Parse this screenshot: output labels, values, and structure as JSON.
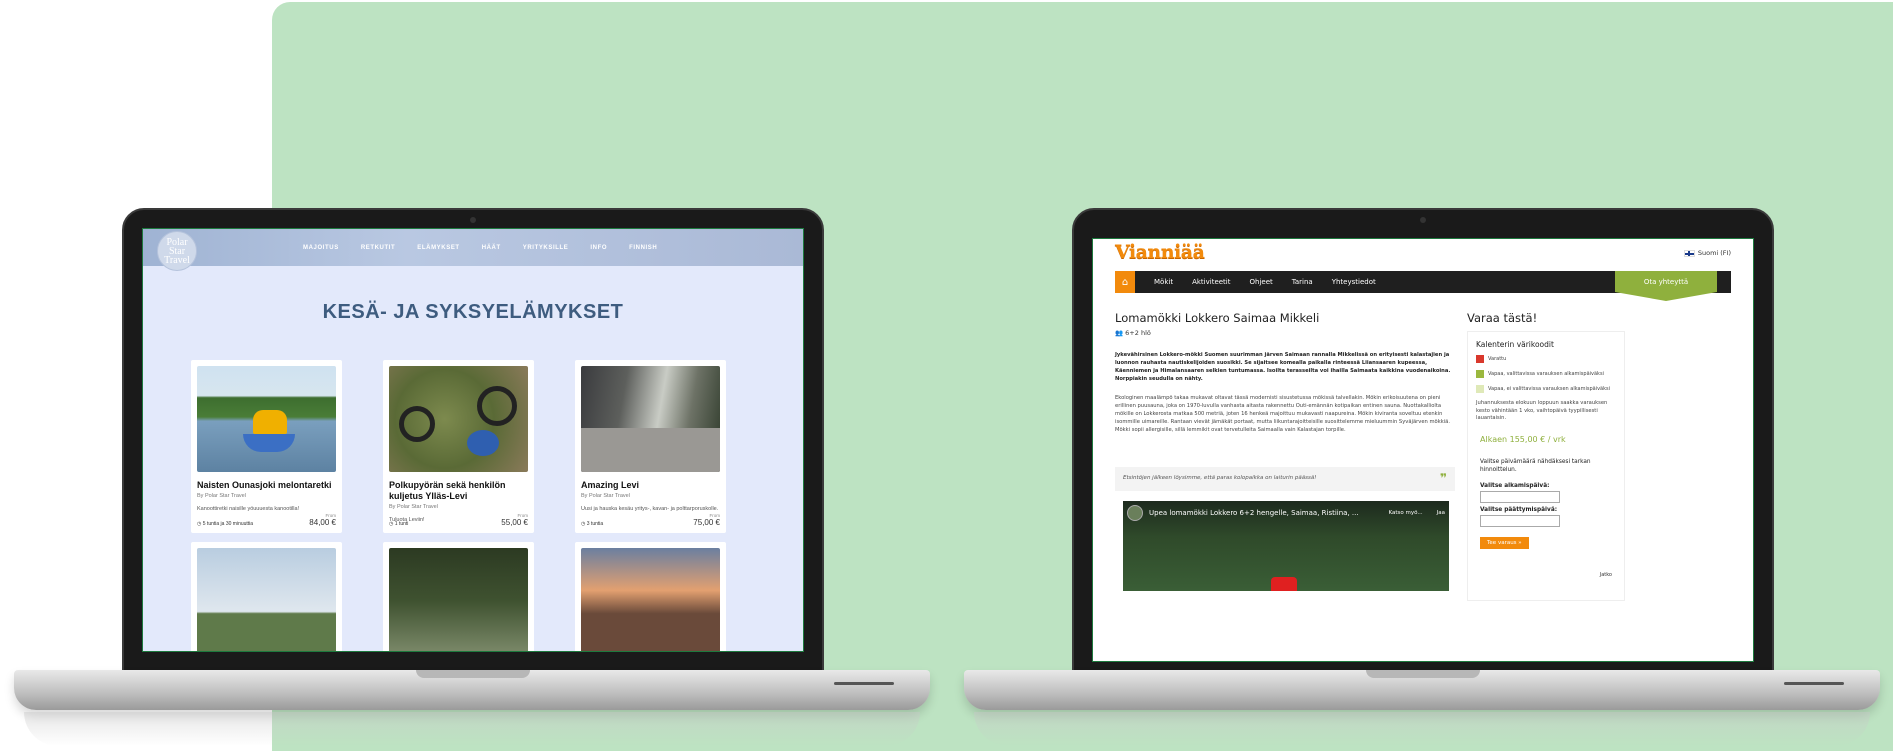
{
  "left_site": {
    "logo": "Polar Star Travel",
    "nav": [
      "MAJOITUS",
      "RETKUTIT",
      "ELÄMYKSET",
      "HÄÄT",
      "YRITYKSILLE",
      "INFO",
      "FINNISH"
    ],
    "title": "KESÄ- JA SYKSYELÄMYKSET",
    "cards": [
      {
        "title": "Naisten Ounasjoki melontaretki",
        "by": "By Polar Star Travel",
        "desc": "Kanoottiretki naisille yöuuuesta kanootilla!",
        "duration": "5 tuntia ja 30 minuuttia",
        "from": "From",
        "price": "84,00 €"
      },
      {
        "title": "Polkupyörän sekä henkilön kuljetus Ylläs-Levi",
        "by": "By Polar Star Travel",
        "desc": "Tuluota Leviin!",
        "duration": "1 tunti",
        "from": "From",
        "price": "55,00 €"
      },
      {
        "title": "Amazing Levi",
        "by": "By Polar Star Travel",
        "desc": "Uusi ja hauska kesäu yritys-, kavan- ja polttarporuskolle.",
        "duration": "3 tuntia",
        "from": "From",
        "price": "75,00 €"
      }
    ]
  },
  "right_site": {
    "logo": "Vianniää",
    "language": "Suomi (FI)",
    "nav": [
      "Mökit",
      "Aktiviteetit",
      "Ohjeet",
      "Tarina",
      "Yhteystiedot"
    ],
    "contact_button": "Ota yhteyttä",
    "title": "Lomamökki Lokkero Saimaa Mikkeli",
    "people": "6+2 hlö",
    "intro": "Jykevähirsinen Lokkero-mökki Suomen suurimman järven Saimaan rannalla Mikkelissä on erityisesti kalastajien ja luonnon rauhasta nautiskelijoiden suosikki. Se sijaitsee komealla paikalla rinteessä Liiansaaren kupeessa, Käenniemen ja Himalansaaren selkien tuntumassa. Isoilta terasseilta voi ihailla Saimaata kaikkina vuodenaikoina. Norppiakin seudulla on nähty.",
    "body": "Ekologinen maalämpö takaa mukavat oltavat tässä modernisti sisustetussa mökissä talvellakin. Mökin erikoisuutena on pieni erillinen puusauna, joka on 1970-luvulla vanhasta aitasta rakennettu Outi-emännän kotipaikan entinen sauna. Nuottakalliolta mökille on Lokkerosta matkaa 500 metriä, joten 16 henkeä majoittuu mukavasti naapureina. Mökin kiviranta soveltuu etenkin isommille uimareille. Rantaan vievät jämäkät portaat, mutta liikuntarajoitteisille suosittelemme mieluummin Syväjärven mökkiä. Mökki sopii allergisille, sillä lemmikit ovat tervetulleita Saimaalla vain Kalastajan torpille.",
    "quote": "Etsintöjen jälkeen löysimme, että paras kolopaikka on laiturin päässä!",
    "video_title": "Upea lomamökki Lokkero 6+2 hengelle, Saimaa, Ristiina, ...",
    "video_watch": "Katso myö...",
    "video_share": "Jaa",
    "side_title": "Varaa tästä!",
    "calendar_title": "Kalenterin värikoodit",
    "legend": [
      {
        "label": "Varattu",
        "color": "#d9382c"
      },
      {
        "label": "Vapaa, valittavissa varauksen alkamispäiväksi",
        "color": "#9bb83e"
      },
      {
        "label": "Vapaa, ei valittavissa varauksen alkamispäiväksi",
        "color": "#dfe9b8"
      }
    ],
    "note": "Juhannuksesta elokuun loppuun saakka varauksen kesto vähintään 1 vko, vaihtopäivä tyypillisesti lauantaisin.",
    "price": "Alkaen 155,00 € / vrk",
    "select_text": "Valitse päivämäärä nähdäksesi tarkan hinnoittelun.",
    "start_label": "Valitse alkamispäivä:",
    "end_label": "Valitse päättymispäivä:",
    "book_button": "Tee varaus »",
    "more": "Jatko"
  }
}
